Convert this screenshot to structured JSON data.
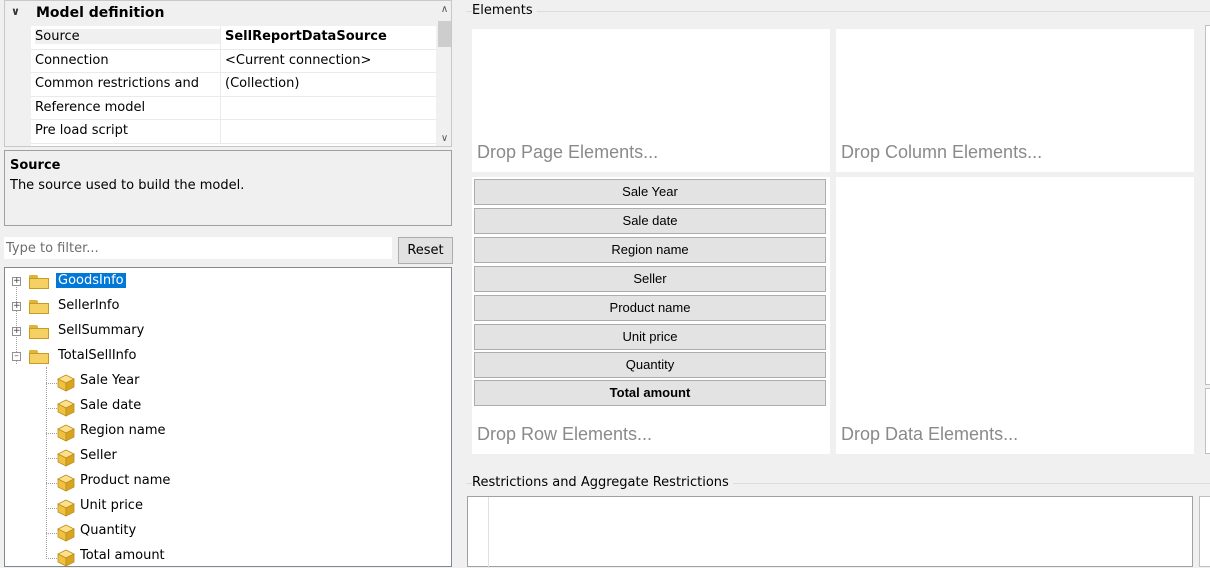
{
  "property_grid": {
    "category": "Model definition",
    "rows": [
      {
        "name": "Source",
        "value": "SellReportDataSource"
      },
      {
        "name": "Connection",
        "value": "<Current connection>"
      },
      {
        "name": "Common restrictions and",
        "value": "(Collection)"
      },
      {
        "name": "Reference model",
        "value": ""
      },
      {
        "name": "Pre load script",
        "value": ""
      }
    ]
  },
  "description": {
    "title": "Source",
    "text": "The source used to build the model."
  },
  "filter": {
    "placeholder": "Type to filter...",
    "reset_label": "Reset"
  },
  "tree": {
    "folders": [
      {
        "label": "GoodsInfo",
        "expanded": false,
        "selected": true
      },
      {
        "label": "SellerInfo",
        "expanded": false
      },
      {
        "label": "SellSummary",
        "expanded": false
      },
      {
        "label": "TotalSellInfo",
        "expanded": true
      }
    ],
    "children": [
      "Sale Year",
      "Sale date",
      "Region name",
      "Seller",
      "Product name",
      "Unit price",
      "Quantity",
      "Total amount"
    ]
  },
  "elements": {
    "title": "Elements",
    "drop_page": "Drop Page Elements...",
    "drop_column": "Drop Column Elements...",
    "drop_row": "Drop Row Elements...",
    "drop_data": "Drop Data Elements...",
    "row_items": [
      "Sale Year",
      "Sale date",
      "Region name",
      "Seller",
      "Product name",
      "Unit price",
      "Quantity",
      "Total amount"
    ]
  },
  "restrictions": {
    "title": "Restrictions and Aggregate Restrictions"
  },
  "colors": {
    "selection": "#0078d7",
    "folder": "#f4d162",
    "cube": "#f0c040"
  }
}
